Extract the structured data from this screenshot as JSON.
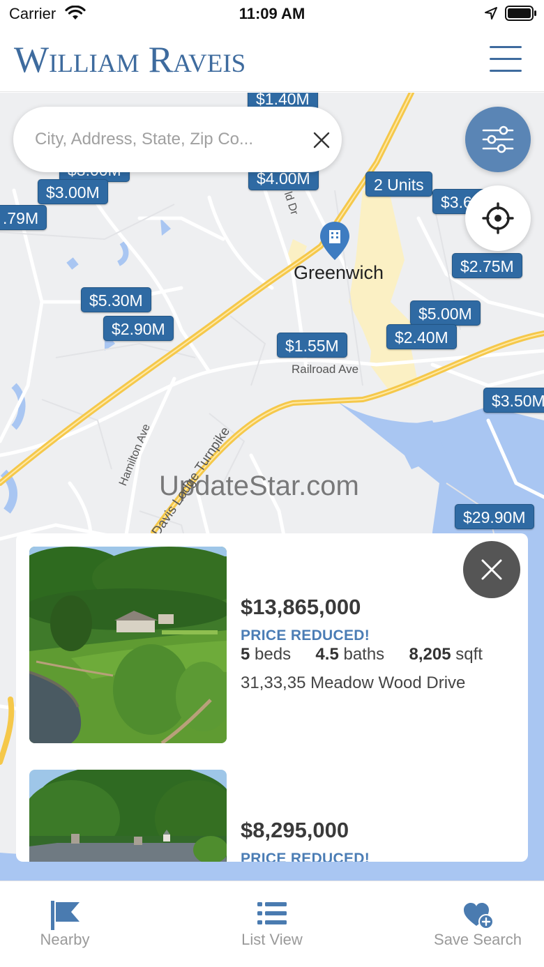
{
  "status_bar": {
    "carrier": "Carrier",
    "time": "11:09 AM"
  },
  "header": {
    "brand": "William Raveis"
  },
  "search": {
    "placeholder": "City, Address, State, Zip Co..."
  },
  "map": {
    "place_label": "Greenwich",
    "street_labels": [
      "Railroad Ave",
      "Hamilton Ave",
      "Davis Lodge Turnpike",
      "ld Dr"
    ],
    "watermark": "UpdateStar.com",
    "pins": [
      {
        "label": "$1.40M"
      },
      {
        "label": "$3.00M"
      },
      {
        "label": "$3.00M"
      },
      {
        "label": "$4.00M"
      },
      {
        "label": "2 Units"
      },
      {
        "label": "$3.60M"
      },
      {
        "label": ".79M"
      },
      {
        "label": "$2.75M"
      },
      {
        "label": "$5.30M"
      },
      {
        "label": "$2.90M"
      },
      {
        "label": "$5.00M"
      },
      {
        "label": "$1.55M"
      },
      {
        "label": "$2.40M"
      },
      {
        "label": "$3.50M"
      },
      {
        "label": "$29.90M"
      }
    ]
  },
  "listings": [
    {
      "price": "$13,865,000",
      "status": "PRICE REDUCED!",
      "beds_value": "5",
      "beds_unit": "beds",
      "baths_value": "4.5",
      "baths_unit": "baths",
      "sqft_value": "8,205",
      "sqft_unit": "sqft",
      "address": "31,33,35 Meadow Wood Drive"
    },
    {
      "price": "$8,295,000",
      "status": "PRICE REDUCED!"
    }
  ],
  "tabs": [
    {
      "label": "Nearby",
      "icon": "flag-icon"
    },
    {
      "label": "List View",
      "icon": "list-icon"
    },
    {
      "label": "Save Search",
      "icon": "heart-plus-icon"
    }
  ],
  "colors": {
    "brand": "#3e6b9e",
    "pin": "#2f6aa3",
    "status_text": "#4b7db5",
    "water": "#a9c6f2",
    "highway": "#f5c84a"
  }
}
